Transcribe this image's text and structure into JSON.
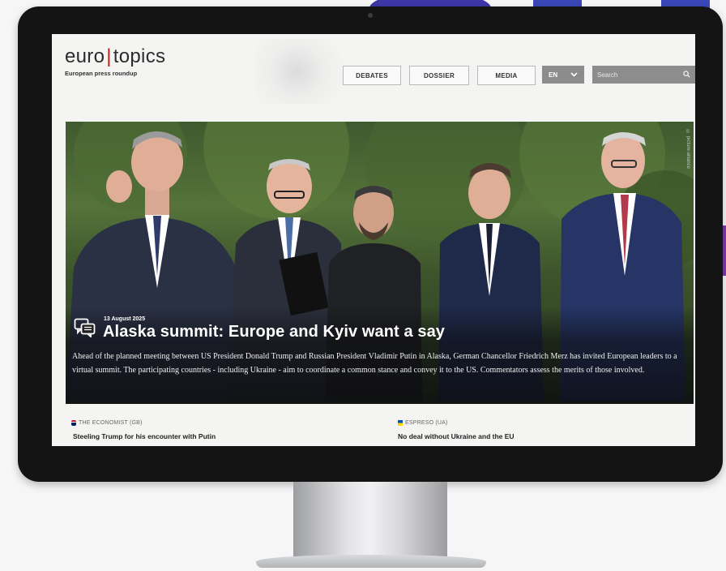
{
  "site": {
    "logo_left": "euro",
    "logo_sep": "|",
    "logo_right": "topics",
    "tagline": "European press roundup"
  },
  "nav": {
    "items": [
      "DEBATES",
      "DOSSIER",
      "MEDIA"
    ],
    "language": "EN",
    "search_placeholder": "Search"
  },
  "hero": {
    "date": "13 August 2025",
    "title": "Alaska summit: Europe and Kyiv want a say",
    "lead": "Ahead of the planned meeting between US President Donald Trump and Russian President Vladimir Putin in Alaska, German Chancellor Friedrich Merz has invited European leaders to a virtual summit. The participating countries - including Ukraine - aim to coordinate a common stance and convey it to the US. Commentators assess the merits of those involved.",
    "photo_credit": "© picture-alliance"
  },
  "articles": [
    {
      "source": "THE ECONOMIST (GB)",
      "headline": "Steeling Trump for his encounter with Putin",
      "flag": "gb"
    },
    {
      "source": "ESPRESO (UA)",
      "headline": "No deal without Ukraine and the EU",
      "flag": "ua"
    }
  ],
  "colors": {
    "accent": "#b91c1c",
    "bezel": "#141414",
    "nav_grey": "#8c8c8c"
  }
}
